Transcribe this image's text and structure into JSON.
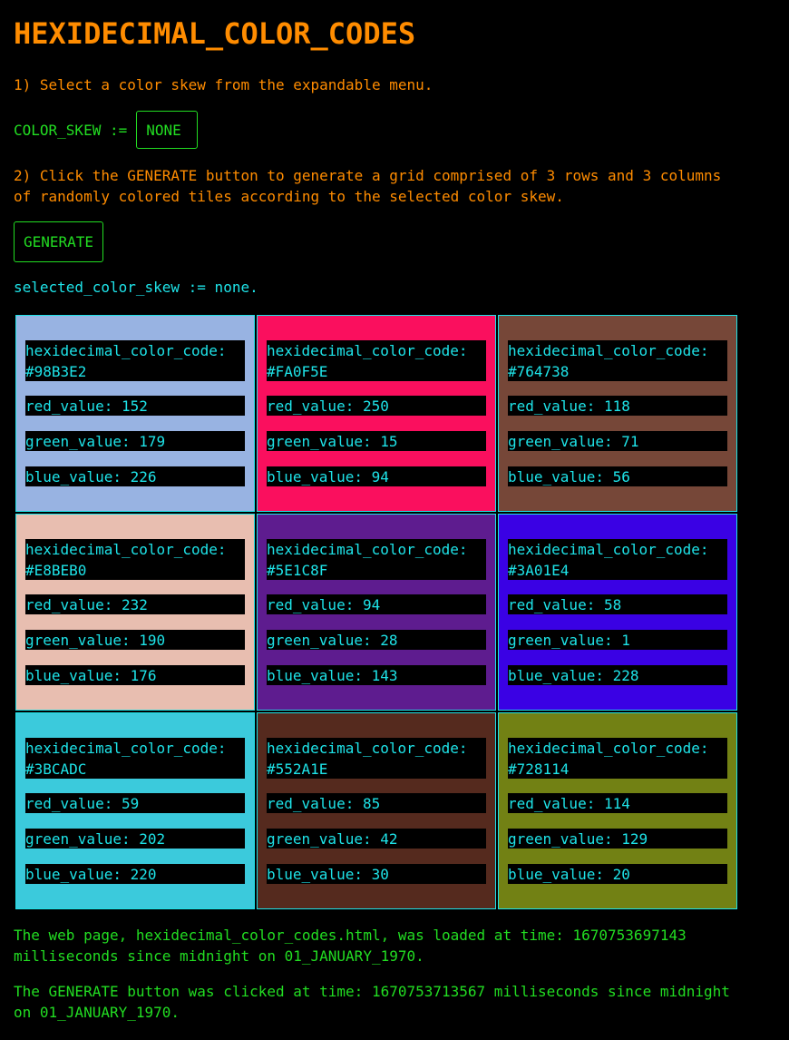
{
  "title": "HEXIDECIMAL_COLOR_CODES",
  "step1": "1) Select a color skew from the expandable menu.",
  "skew_label": "COLOR_SKEW :=",
  "skew_value": "NONE",
  "step2": "2) Click the GENERATE button to generate a grid comprised of 3 rows and 3 columns\nof randomly colored tiles according to the selected color skew.",
  "generate_label": "GENERATE",
  "selected_skew": "selected_color_skew := none.",
  "tiles": [
    {
      "hex": "hexidecimal_color_code:\n#98B3E2",
      "color": "#98B3E2",
      "red": "red_value: 152",
      "green": "green_value: 179",
      "blue": "blue_value: 226"
    },
    {
      "hex": "hexidecimal_color_code:\n#FA0F5E",
      "color": "#FA0F5E",
      "red": "red_value: 250",
      "green": "green_value: 15",
      "blue": "blue_value: 94"
    },
    {
      "hex": "hexidecimal_color_code:\n#764738",
      "color": "#764738",
      "red": "red_value: 118",
      "green": "green_value: 71",
      "blue": "blue_value: 56"
    },
    {
      "hex": "hexidecimal_color_code:\n#E8BEB0",
      "color": "#E8BEB0",
      "red": "red_value: 232",
      "green": "green_value: 190",
      "blue": "blue_value: 176"
    },
    {
      "hex": "hexidecimal_color_code:\n#5E1C8F",
      "color": "#5E1C8F",
      "red": "red_value: 94",
      "green": "green_value: 28",
      "blue": "blue_value: 143"
    },
    {
      "hex": "hexidecimal_color_code:\n#3A01E4",
      "color": "#3A01E4",
      "red": "red_value: 58",
      "green": "green_value: 1",
      "blue": "blue_value: 228"
    },
    {
      "hex": "hexidecimal_color_code:\n#3BCADC",
      "color": "#3BCADC",
      "red": "red_value: 59",
      "green": "green_value: 202",
      "blue": "blue_value: 220"
    },
    {
      "hex": "hexidecimal_color_code:\n#552A1E",
      "color": "#552A1E",
      "red": "red_value: 85",
      "green": "green_value: 42",
      "blue": "blue_value: 30"
    },
    {
      "hex": "hexidecimal_color_code:\n#728114",
      "color": "#728114",
      "red": "red_value: 114",
      "green": "green_value: 129",
      "blue": "blue_value: 20"
    }
  ],
  "loaded_text": "The web page, hexidecimal_color_codes.html, was loaded at time: 1670753697143\nmilliseconds since midnight on 01_JANUARY_1970.",
  "clicked_text": "The GENERATE button was clicked at time: 1670753713567 milliseconds since midnight\non 01_JANUARY_1970."
}
